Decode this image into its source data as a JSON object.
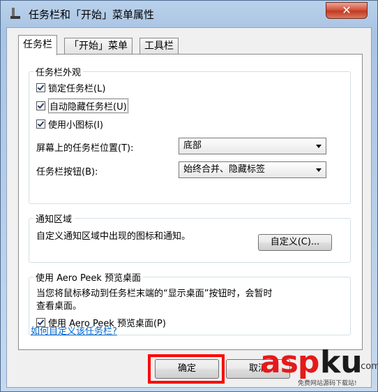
{
  "window": {
    "title": "任务栏和「开始」菜单属性",
    "close_glyph": "✕"
  },
  "tabs": [
    {
      "label": "任务栏",
      "active": true
    },
    {
      "label": "「开始」菜单",
      "active": false
    },
    {
      "label": "工具栏",
      "active": false
    }
  ],
  "appearance": {
    "title": "任务栏外观",
    "lock_label": "锁定任务栏(L)",
    "lock_checked": true,
    "autohide_label": "自动隐藏任务栏(U)",
    "autohide_checked": true,
    "small_icons_label": "使用小图标(I)",
    "small_icons_checked": true,
    "position_label": "屏幕上的任务栏位置(T):",
    "position_value": "底部",
    "buttons_label": "任务栏按钮(B):",
    "buttons_value": "始终合并、隐藏标签"
  },
  "notification": {
    "title": "通知区域",
    "description": "自定义通知区域中出现的图标和通知。",
    "customize_label": "自定义(C)..."
  },
  "aero_peek": {
    "title": "使用 Aero Peek 预览桌面",
    "description_line1": "当您将鼠标移动到任务栏末端的“显示桌面”按钮时，会暂时",
    "description_line2": "查看桌面。",
    "checkbox_label": "使用 Aero Peek 预览桌面(P)",
    "checked": true
  },
  "help_link": "如何自定义该任务栏?",
  "footer": {
    "ok_label": "确定",
    "cancel_label": "取消"
  },
  "watermark": {
    "part1": "asp",
    "part2": "ku",
    "suffix": ".com",
    "tagline": "免费网站源码下载站!"
  },
  "colors": {
    "highlight": "#ff0000",
    "link": "#0066cc",
    "close_button": "#c23a22"
  }
}
